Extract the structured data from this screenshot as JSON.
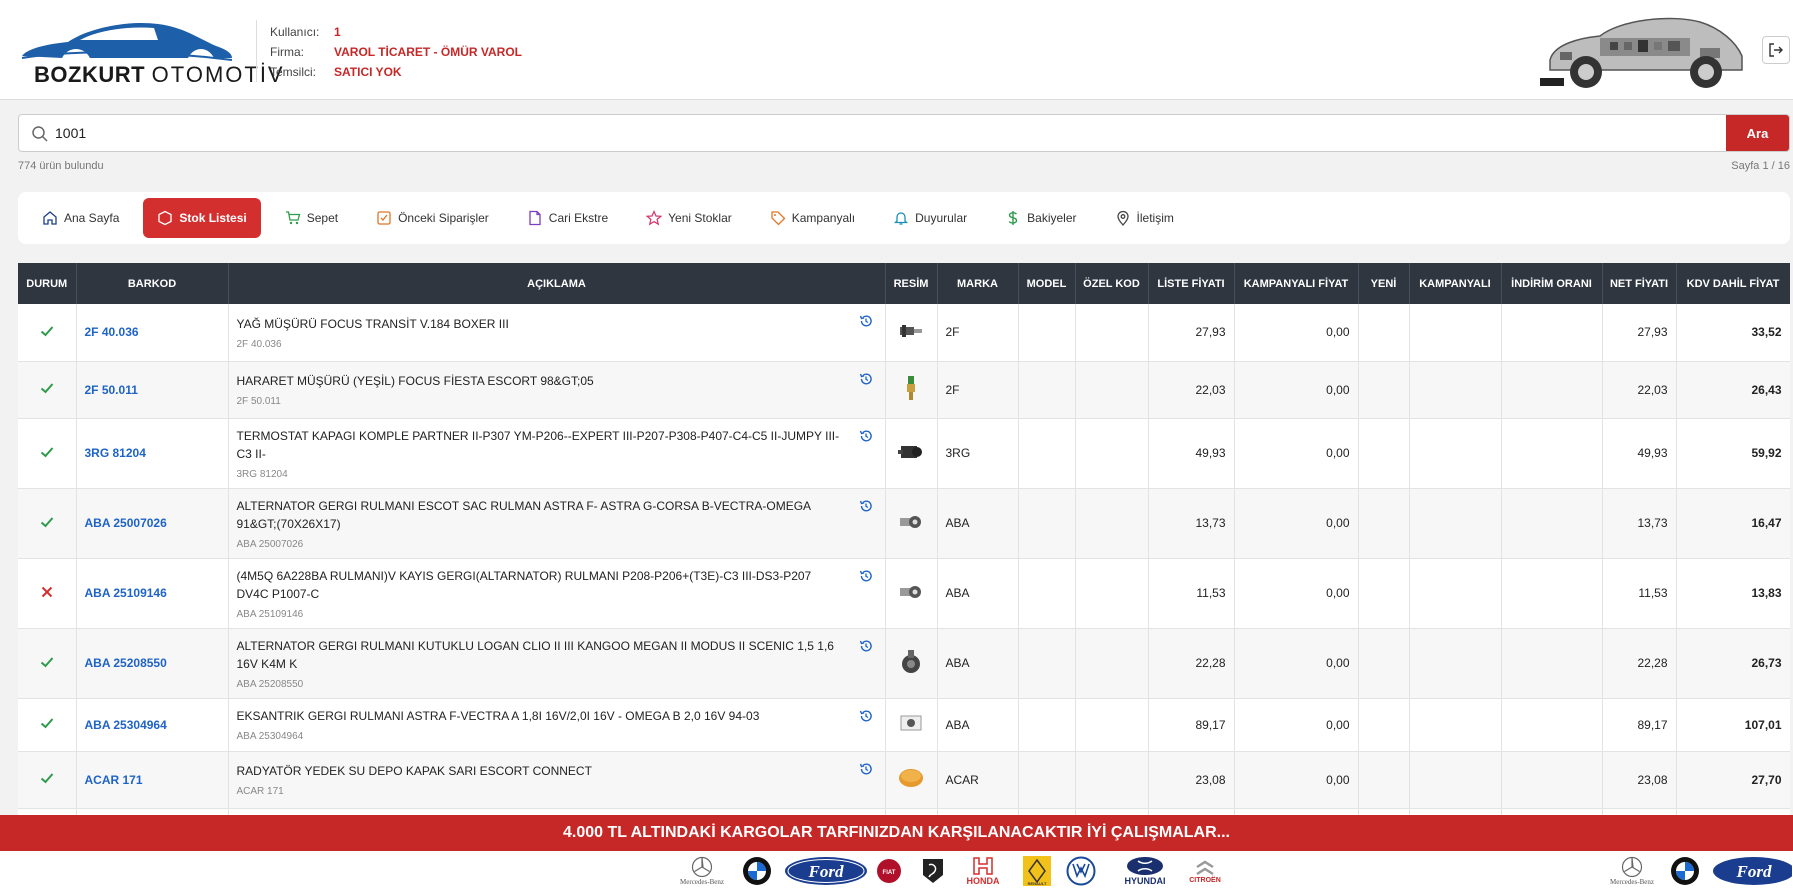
{
  "brand": {
    "name_bold": "BOZKURT",
    "name_rest": "OTOMOTİV"
  },
  "user": {
    "kullanici_label": "Kullanıcı:",
    "kullanici": "1",
    "firma_label": "Firma:",
    "firma": "VAROL TİCARET - ÖMÜR VAROL",
    "temsilci_label": "Temsilci:",
    "temsilci": "SATICI YOK"
  },
  "search": {
    "value": "1001",
    "button": "Ara",
    "results": "774 ürün bulundu",
    "page": "Sayfa 1 / 16"
  },
  "nav": [
    {
      "label": "Ana Sayfa",
      "icon": "home-icon"
    },
    {
      "label": "Stok Listesi",
      "icon": "box-icon",
      "active": true
    },
    {
      "label": "Sepet",
      "icon": "cart-icon"
    },
    {
      "label": "Önceki Siparişler",
      "icon": "checklist-icon"
    },
    {
      "label": "Cari Ekstre",
      "icon": "document-icon"
    },
    {
      "label": "Yeni Stoklar",
      "icon": "star-icon"
    },
    {
      "label": "Kampanyalı",
      "icon": "tag-icon"
    },
    {
      "label": "Duyurular",
      "icon": "bell-icon"
    },
    {
      "label": "Bakiyeler",
      "icon": "dollar-icon"
    },
    {
      "label": "İletişim",
      "icon": "location-icon"
    }
  ],
  "table": {
    "headers": [
      "DURUM",
      "BARKOD",
      "AÇIKLAMA",
      "RESİM",
      "MARKA",
      "MODEL",
      "ÖZEL KOD",
      "LİSTE FİYATI",
      "KAMPANYALI FİYAT",
      "YENİ",
      "KAMPANYALI",
      "İNDİRİM ORANI",
      "NET FİYATI",
      "KDV DAHİL FİYAT"
    ],
    "rows": [
      {
        "status": "ok",
        "barkod": "2F 40.036",
        "title": "YAĞ MÜŞÜRÜ FOCUS TRANSİT V.184 BOXER III",
        "code": "2F 40.036",
        "marka": "2F",
        "liste": "27,93",
        "kamp": "0,00",
        "net": "27,93",
        "kdv": "33,52",
        "img": "sensor-gray"
      },
      {
        "status": "ok",
        "barkod": "2F 50.011",
        "title": "HARARET MÜŞÜRÜ (YEŞİL) FOCUS FİESTA ESCORT 98&GT;05",
        "code": "2F 50.011",
        "marka": "2F",
        "liste": "22,03",
        "kamp": "0,00",
        "net": "22,03",
        "kdv": "26,43",
        "img": "sensor-green"
      },
      {
        "status": "ok",
        "barkod": "3RG 81204",
        "title": "TERMOSTAT KAPAGI KOMPLE PARTNER II-P307 YM-P206--EXPERT III-P207-P308-P407-C4-C5 II-JUMPY III-C3 II-",
        "code": "3RG 81204",
        "marka": "3RG",
        "liste": "49,93",
        "kamp": "0,00",
        "net": "49,93",
        "kdv": "59,92",
        "img": "thermostat"
      },
      {
        "status": "ok",
        "barkod": "ABA 25007026",
        "title": "ALTERNATOR GERGI RULMANI ESCOT SAC RULMAN ASTRA F- ASTRA G-CORSA B-VECTRA-OMEGA 91&GT;(70X26X17)",
        "code": "ABA 25007026",
        "marka": "ABA",
        "liste": "13,73",
        "kamp": "0,00",
        "net": "13,73",
        "kdv": "16,47",
        "img": "bearing"
      },
      {
        "status": "no",
        "barkod": "ABA 25109146",
        "title": "(4M5Q 6A228BA RULMANI)V KAYIS GERGI(ALTARNATOR) RULMANI P208-P206+(T3E)-C3 III-DS3-P207 DV4C P1007-C",
        "code": "ABA 25109146",
        "marka": "ABA",
        "liste": "11,53",
        "kamp": "0,00",
        "net": "11,53",
        "kdv": "13,83",
        "img": "bearing"
      },
      {
        "status": "ok",
        "barkod": "ABA 25208550",
        "title": "ALTERNATOR GERGI RULMANI KUTUKLU LOGAN CLIO II III KANGOO MEGAN II MODUS II SCENIC 1,5 1,6 16V K4M K",
        "code": "ABA 25208550",
        "marka": "ABA",
        "liste": "22,28",
        "kamp": "0,00",
        "net": "22,28",
        "kdv": "26,73",
        "img": "tensioner"
      },
      {
        "status": "ok",
        "barkod": "ABA 25304964",
        "title": "EKSANTRIK GERGI RULMANI ASTRA F-VECTRA A 1,8I 16V/2,0I 16V - OMEGA B 2,0 16V 94-03",
        "code": "ABA 25304964",
        "marka": "ABA",
        "liste": "89,17",
        "kamp": "0,00",
        "net": "89,17",
        "kdv": "107,01",
        "img": "box"
      },
      {
        "status": "ok",
        "barkod": "ACAR 171",
        "title": "RADYATÖR YEDEK SU DEPO KAPAK SARI ESCORT CONNECT",
        "code": "ACAR 171",
        "marka": "ACAR",
        "liste": "23,08",
        "kamp": "0,00",
        "net": "23,08",
        "kdv": "27,70",
        "img": "cap"
      }
    ]
  },
  "banner": "4.000 TL ALTINDAKİ KARGOLAR TARFINIZDAN KARŞILANACAKTIR İYİ ÇALIŞMALAR...",
  "brands": [
    "Mercedes-Benz",
    "BMW",
    "Ford",
    "FIAT",
    "PEUGEOT",
    "HONDA",
    "RENAULT",
    "VW",
    "HYUNDAI",
    "CITROËN",
    "Mercedes-Benz",
    "BMW",
    "Ford"
  ],
  "colors": {
    "accent": "#c62828",
    "header_dark": "#2f3640",
    "link": "#1e63c7",
    "ok": "#2e9b4b",
    "no": "#d32f2f"
  }
}
